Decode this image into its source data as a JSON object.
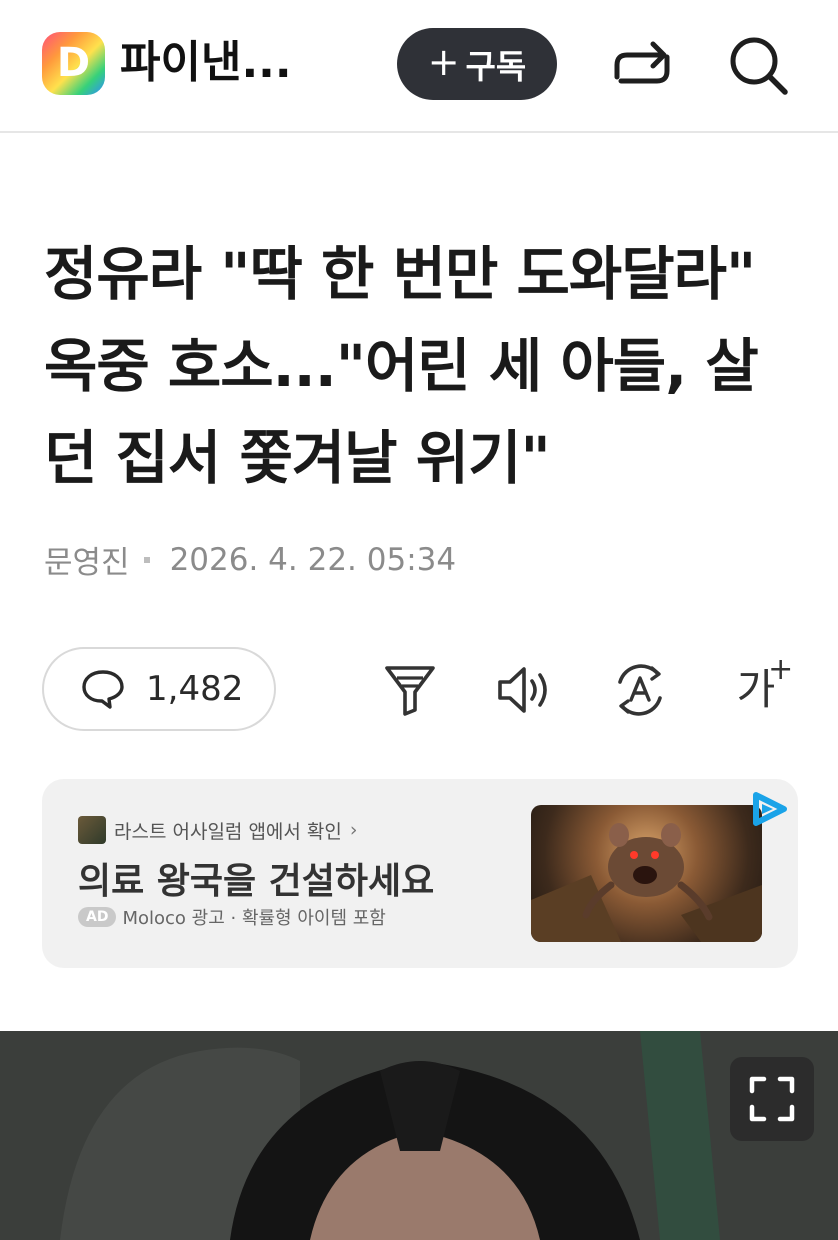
{
  "header": {
    "logo_letter": "D",
    "channel_name": "파이낸...",
    "subscribe_plus": "+",
    "subscribe_label": "구독",
    "icons": [
      "share-icon",
      "search-icon"
    ]
  },
  "article": {
    "title": "정유라 \"딱 한 번만 도와달라\" 옥중 호소...\"어린 세 아들, 살던 집서 쫓겨날 위기\"",
    "author": "문영진",
    "date": "2026. 4. 22. 05:34"
  },
  "actions": {
    "comment_count": "1,482",
    "font_glyph": "가",
    "font_plus": "+",
    "icons": [
      "comment-icon",
      "summary-filter-icon",
      "audio-icon",
      "translate-icon",
      "font-size-icon"
    ]
  },
  "ad": {
    "source": "라스트 어사일럼 앱에서 확인",
    "source_chevron": "›",
    "headline": "의료 왕국을 건설하세요",
    "badge": "AD",
    "footer": "Moloco 광고 · 확률형 아이템 포함",
    "adchoices_color": "#1aa3e8"
  },
  "photo": {
    "icons": [
      "expand-icon"
    ]
  },
  "colors": {
    "subscribe_bg": "#2f3137",
    "ad_bg": "#f1f1f1",
    "meta_text": "#8b8b8b"
  }
}
